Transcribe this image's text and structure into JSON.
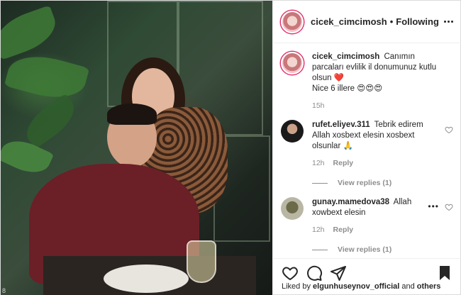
{
  "post": {
    "username": "cicek_cimcimosh",
    "follow_status": "Following",
    "caption_text": "Canımın parcaları evlilik il donumunuz kutlu olsun",
    "caption_heart": "❤️",
    "caption_line2": "Nice 6 illere",
    "caption_emojis": "😍😍😍",
    "caption_time": "15h"
  },
  "comments": [
    {
      "username": "rufet.eliyev.311",
      "text": "Tebrik edirem Allah xosbext elesin xosbext olsunlar",
      "emoji": "🙏",
      "time": "12h",
      "reply_label": "Reply",
      "view_replies": "View replies (1)"
    },
    {
      "username": "gunay.mamedova38",
      "text": "Allah xowbext elesin",
      "time": "12h",
      "reply_label": "Reply",
      "view_replies": "View replies (1)",
      "more": "•••"
    }
  ],
  "likes": {
    "prefix": "Liked by",
    "user": "elgunhuseynov_official",
    "middle": "and",
    "others": "others"
  },
  "photo": {
    "watermark": "8"
  },
  "icons": {
    "header_more": "more-options-icon",
    "like": "heart-icon",
    "comment": "comment-icon",
    "share": "share-icon",
    "save": "bookmark-icon"
  },
  "colors": {
    "heart_red": "#ed4956",
    "text": "#262626",
    "muted": "#8e8e8e"
  }
}
